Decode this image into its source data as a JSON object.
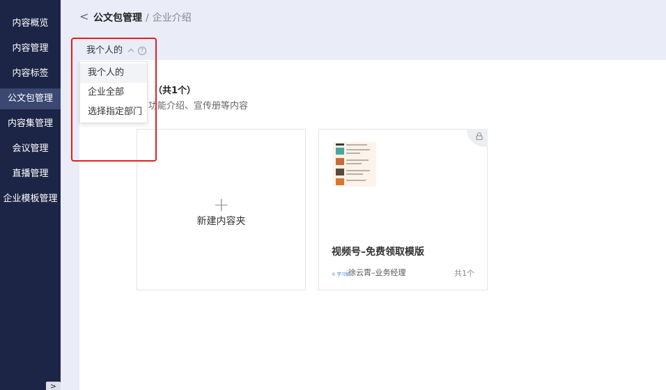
{
  "sidebar": {
    "items": [
      {
        "label": "内容概览"
      },
      {
        "label": "内容管理"
      },
      {
        "label": "内容标签"
      },
      {
        "label": "公文包管理"
      },
      {
        "label": "内容集管理"
      },
      {
        "label": "会议管理"
      },
      {
        "label": "直播管理"
      },
      {
        "label": "企业模板管理"
      }
    ],
    "active_index": 3,
    "collapse_icon": ">"
  },
  "header": {
    "back_icon": "<",
    "breadcrumb_main": "公文包管理",
    "breadcrumb_separator": "/",
    "breadcrumb_current": "企业介绍"
  },
  "filter": {
    "label": "我个人的",
    "help_icon": "?",
    "options": [
      "我个人的",
      "企业全部",
      "选择指定部门"
    ],
    "selected_index": 0
  },
  "section": {
    "count_text": "（共1个）",
    "description": "功能介绍、宣传册等内容"
  },
  "new_folder": {
    "plus": "+",
    "label": "新建内容夹"
  },
  "folders": [
    {
      "title": "视频号–免费领取模版",
      "owner_logo": "© 学习版",
      "owner": "徐云霄–业务经理",
      "count": "共1个"
    }
  ],
  "colors": {
    "sidebar_bg": "#1d2546",
    "sidebar_active": "#3a4872",
    "topbar_bg": "#eaecf7",
    "highlight": "#e02020"
  }
}
